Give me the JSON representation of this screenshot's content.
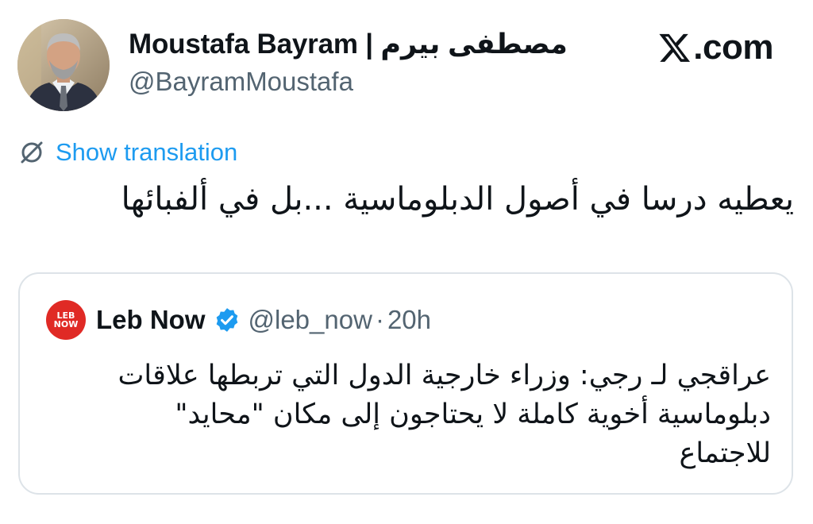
{
  "author": {
    "display_name": "Moustafa Bayram | مصطفى بيرم",
    "handle": "@BayramMoustafa",
    "avatar_icon": "profile-photo"
  },
  "brand": {
    "icon": "x-logo-icon",
    "domain": ".com"
  },
  "translation": {
    "icon": "globe-slash-icon",
    "label": "Show translation",
    "color": "#1d9bf0"
  },
  "tweet": {
    "text": "يعطيه درسا في أصول الدبلوماسية ...بل في ألفبائها"
  },
  "quoted_tweet": {
    "avatar_text_top": "LEB",
    "avatar_text_bottom": "NOW",
    "avatar_color": "#e02a25",
    "display_name": "Leb Now",
    "verified_icon": "verified-badge-icon",
    "verified_color": "#1d9bf0",
    "handle": "@leb_now",
    "separator": "·",
    "time": "20h",
    "lines": [
      "عراقجي لـ رجي: وزراء خارجية الدول التي تربطها علاقات",
      "دبلوماسية أخوية كاملة لا يحتاجون إلى مكان \"محايد\"",
      "للاجتماع"
    ]
  }
}
